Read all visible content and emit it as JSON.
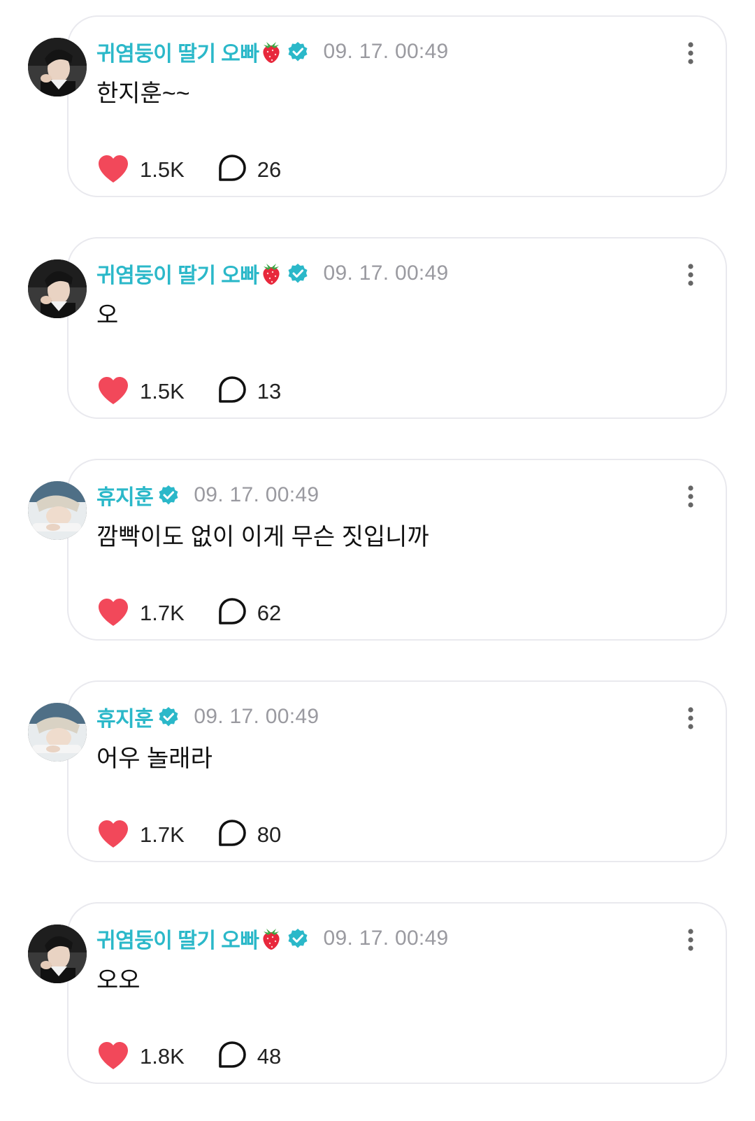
{
  "posts": [
    {
      "author": "귀염둥이 딸기 오빠",
      "author_emoji": "strawberry-icon",
      "timestamp": "09. 17. 00:49",
      "message": "한지훈~~",
      "likes": "1.5K",
      "comments": "26",
      "avatar": "avatar-dark-hair"
    },
    {
      "author": "귀염둥이 딸기 오빠",
      "author_emoji": "strawberry-icon",
      "timestamp": "09. 17. 00:49",
      "message": "오",
      "likes": "1.5K",
      "comments": "13",
      "avatar": "avatar-dark-hair"
    },
    {
      "author": "휴지훈",
      "author_emoji": "",
      "timestamp": "09. 17. 00:49",
      "message": "깜빡이도 없이 이게 무슨 짓입니까",
      "likes": "1.7K",
      "comments": "62",
      "avatar": "avatar-light-hair"
    },
    {
      "author": "휴지훈",
      "author_emoji": "",
      "timestamp": "09. 17. 00:49",
      "message": "어우 놀래라",
      "likes": "1.7K",
      "comments": "80",
      "avatar": "avatar-light-hair"
    },
    {
      "author": "귀염둥이 딸기 오빠",
      "author_emoji": "strawberry-icon",
      "timestamp": "09. 17. 00:49",
      "message": "오오",
      "likes": "1.8K",
      "comments": "48",
      "avatar": "avatar-dark-hair"
    }
  ],
  "colors": {
    "author": "#2bb8c9",
    "verified": "#2bb8c9",
    "heart": "#f2485a",
    "timestamp": "#9a9aa0",
    "card_border": "#e9e9ee"
  }
}
